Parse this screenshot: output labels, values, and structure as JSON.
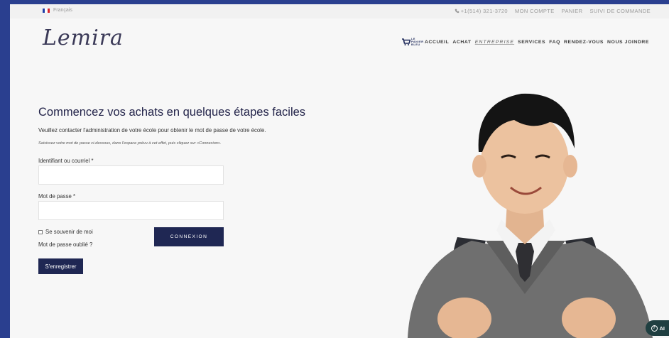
{
  "topbar": {
    "language": "Français",
    "flag_colors": [
      "#1f3ea8",
      "#ffffff",
      "#d8232a"
    ],
    "links": [
      {
        "name": "phone-link",
        "label": "+1(514) 321-3720",
        "icon": "phone-icon"
      },
      {
        "name": "my-account-link",
        "label": "MON COMPTE"
      },
      {
        "name": "cart-link",
        "label": "PANIER"
      },
      {
        "name": "order-tracking-link",
        "label": "SUIVI DE COMMANDE"
      }
    ]
  },
  "header": {
    "logo": "Lemira",
    "cart_badge": "LE PANIER BLEU",
    "nav": [
      {
        "name": "nav-accueil",
        "label": "ACCUEIL"
      },
      {
        "name": "nav-achat",
        "label": "ACHAT"
      },
      {
        "name": "nav-entreprise",
        "label": "ENTREPRISE",
        "style": "thin"
      },
      {
        "name": "nav-services",
        "label": "SERVICES"
      },
      {
        "name": "nav-faq",
        "label": "FAQ"
      },
      {
        "name": "nav-rendez-vous",
        "label": "RENDEZ-VOUS"
      },
      {
        "name": "nav-nous-joindre",
        "label": "NOUS JOINDRE"
      }
    ]
  },
  "main": {
    "title": "Commencez vos achats en quelques étapes faciles",
    "description": "Veuillez contacter l'administration de votre école pour obtenir le mot de passe de votre école.",
    "note": "Saisissez votre mot de passe ci-dessous, dans l'espace prévu à cet effet, puis cliquez sur «Connexion».",
    "username_label": "Identifiant ou courriel *",
    "username_value": "",
    "password_label": "Mot de passe *",
    "password_value": "",
    "remember_label": "Se souvenir de moi",
    "remember_checked": false,
    "login_button": "CONNEXION",
    "lost_password": "Mot de passe oublié ?",
    "register_button": "S'enregistrer"
  },
  "help": {
    "label": "AI",
    "icon": "question-circle-icon"
  },
  "colors": {
    "brand_navy": "#1f2753",
    "help_teal": "#1f3f41",
    "outer_frame": "#2a3f8f"
  }
}
